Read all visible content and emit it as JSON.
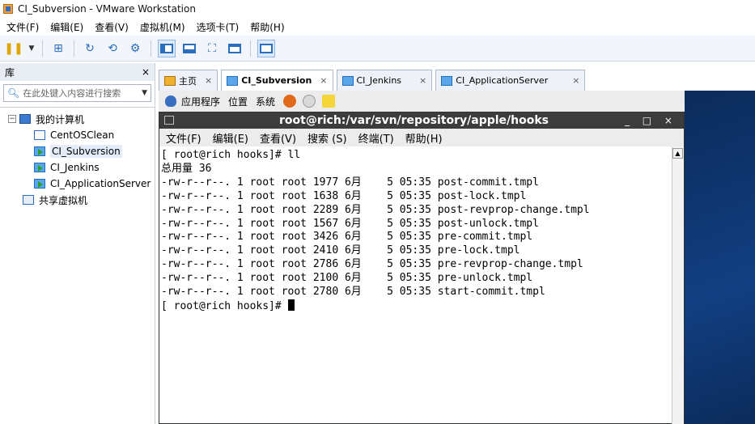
{
  "window": {
    "title": "CI_Subversion - VMware Workstation"
  },
  "menubar": [
    "文件(F)",
    "编辑(E)",
    "查看(V)",
    "虚拟机(M)",
    "选项卡(T)",
    "帮助(H)"
  ],
  "sidebar": {
    "header": "库",
    "close": "×",
    "search_placeholder": "在此处键入内容进行搜索",
    "tree": {
      "root": "我的计算机",
      "children": [
        "CentOSClean",
        "CI_Subversion",
        "CI_Jenkins",
        "CI_ApplicationServer"
      ],
      "shared": "共享虚拟机"
    }
  },
  "tabs": [
    {
      "label": "主页",
      "close": "×"
    },
    {
      "label": "CI_Subversion",
      "close": "×"
    },
    {
      "label": "CI_Jenkins",
      "close": "×"
    },
    {
      "label": "CI_ApplicationServer",
      "close": "×"
    }
  ],
  "guest_panel": {
    "applications": "应用程序",
    "places": "位置",
    "system": "系统"
  },
  "terminal": {
    "title": "root@rich:/var/svn/repository/apple/hooks",
    "window_controls": "_ □ ×",
    "menu": [
      "文件(F)",
      "编辑(E)",
      "查看(V)",
      "搜索 (S)",
      "终端(T)",
      "帮助(H)"
    ],
    "lines": [
      "[ root@rich hooks]# ll",
      "总用量 36",
      "-rw-r--r--. 1 root root 1977 6月    5 05:35 post-commit.tmpl",
      "-rw-r--r--. 1 root root 1638 6月    5 05:35 post-lock.tmpl",
      "-rw-r--r--. 1 root root 2289 6月    5 05:35 post-revprop-change.tmpl",
      "-rw-r--r--. 1 root root 1567 6月    5 05:35 post-unlock.tmpl",
      "-rw-r--r--. 1 root root 3426 6月    5 05:35 pre-commit.tmpl",
      "-rw-r--r--. 1 root root 2410 6月    5 05:35 pre-lock.tmpl",
      "-rw-r--r--. 1 root root 2786 6月    5 05:35 pre-revprop-change.tmpl",
      "-rw-r--r--. 1 root root 2100 6月    5 05:35 pre-unlock.tmpl",
      "-rw-r--r--. 1 root root 2780 6月    5 05:35 start-commit.tmpl"
    ],
    "prompt": "[ root@rich hooks]# "
  }
}
